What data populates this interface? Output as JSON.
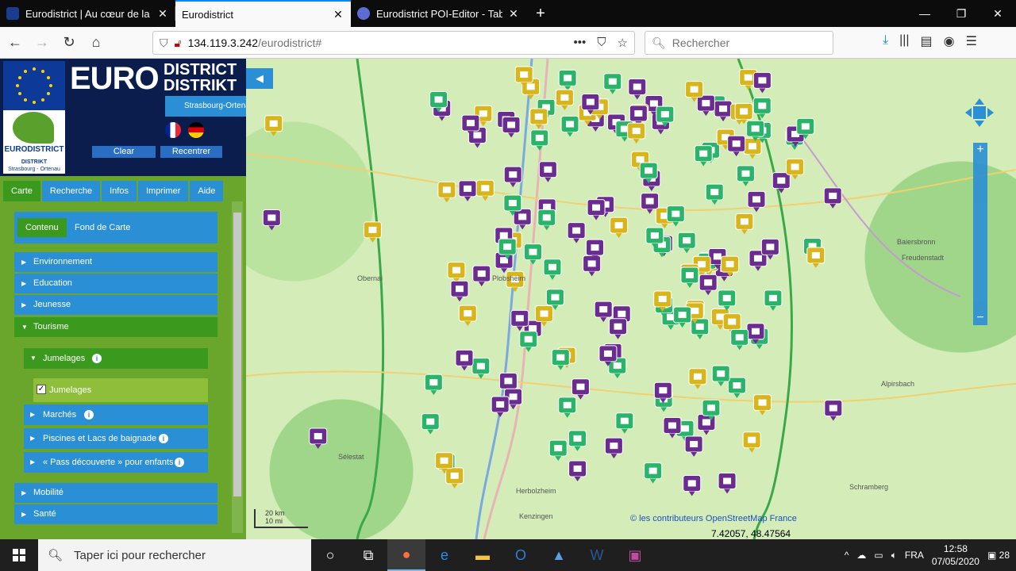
{
  "browser": {
    "tabs": [
      {
        "title": "Eurodistrict | Au cœur de la coo",
        "active": false
      },
      {
        "title": "Eurodistrict",
        "active": true
      },
      {
        "title": "Eurodistrict POI-Editor - Tab be",
        "active": false
      }
    ],
    "url_host": "134.119.3.242",
    "url_path": "/eurodistrict#",
    "search_placeholder": "Rechercher"
  },
  "header": {
    "logo_euro": "EURO",
    "logo_district": "DISTRICT",
    "logo_distrikt": "DISTRIKT",
    "logo_subtitle": "Strasbourg-Ortenau",
    "logo_left_title": "EURODISTRICT",
    "logo_left_sub1": "DISTRIKT",
    "logo_left_sub2": "Strasbourg - Ortenau",
    "clear_label": "Clear",
    "recenter_label": "Recentrer"
  },
  "menu_tabs": [
    "Carte",
    "Recherche",
    "Infos",
    "Imprimer",
    "Aide"
  ],
  "sub_tabs": [
    "Contenu",
    "Fond de Carte"
  ],
  "categories": [
    "Environnement",
    "Education",
    "Jeunesse",
    "Tourisme",
    "Mobilité",
    "Santé"
  ],
  "tourisme_items": [
    "Jumelages",
    "Marchés",
    "Piscines et Lacs de baignade",
    "« Pass découverte » pour enfants"
  ],
  "jumelages_checkbox": "Jumelages",
  "map": {
    "scale_km": "20 km",
    "scale_mi": "10 mi",
    "attribution": "© les contributeurs OpenStreetMap France",
    "coords": "7.42057, 48.47564",
    "places": [
      "Sélestat",
      "Herbolzheim",
      "Kenzingen",
      "Freudenstadt",
      "Baiersbronn",
      "Schramberg",
      "Alpirsbach",
      "Plobsheim",
      "Obernai"
    ]
  },
  "taskbar": {
    "search_placeholder": "Taper ici pour rechercher",
    "lang": "FRA",
    "time": "12:58",
    "date": "07/05/2020",
    "notif": "28"
  },
  "colors": {
    "brand_blue": "#0b1d4d",
    "panel_green": "#6aa62c",
    "tab_blue": "#2a8fd4",
    "poi_purple": "#6a2d8f",
    "poi_gold": "#d9b51c",
    "poi_green": "#2ab46a"
  }
}
